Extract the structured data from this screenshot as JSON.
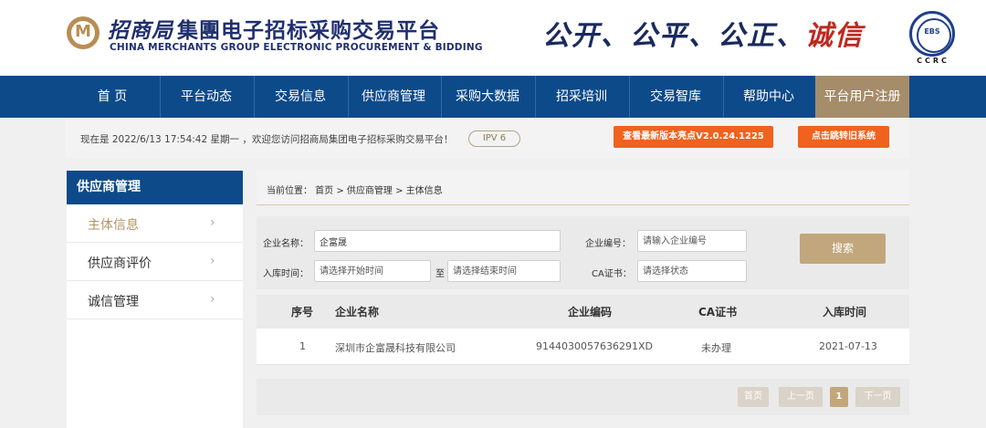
{
  "header": {
    "brand_cn": "招商局",
    "title_cn": "集團电子招标采购交易平台",
    "title_en": "CHINA MERCHANTS GROUP ELECTRONIC PROCUREMENT & BIDDING",
    "slogan_main": "公开、公平、公正、",
    "slogan_red": "诚信",
    "badge_top": "EBS",
    "badge_bottom": "CCRC"
  },
  "nav": {
    "items": [
      {
        "label": "首 页"
      },
      {
        "label": "平台动态"
      },
      {
        "label": "交易信息"
      },
      {
        "label": "供应商管理"
      },
      {
        "label": "采购大数据"
      },
      {
        "label": "招采培训"
      },
      {
        "label": "交易智库"
      },
      {
        "label": "帮助中心"
      },
      {
        "label": "平台用户注册"
      }
    ],
    "active_index": 8
  },
  "infobar": {
    "text": "现在是 2022/6/13 17:54:42 星期一 ，欢迎您访问招商局集团电子招标采购交易平台！",
    "ipv6": "IPV 6",
    "btn_new_version": "查看最新版本亮点V2.0.24.1225",
    "btn_old_system": "点击跳转旧系统"
  },
  "sidebar": {
    "title": "供应商管理",
    "items": [
      {
        "label": "主体信息"
      },
      {
        "label": "供应商评价"
      },
      {
        "label": "诚信管理"
      }
    ],
    "chevron": "›"
  },
  "breadcrumb": "当前位置： 首页 > 供应商管理 > 主体信息",
  "search": {
    "company_name_label": "企业名称：",
    "company_name_value": "企富晟",
    "company_code_label": "企业编号：",
    "company_code_placeholder": "请输入企业编号",
    "date_label": "入库时间：",
    "date_start_placeholder": "请选择开始时间",
    "date_to": "至",
    "date_end_placeholder": "请选择结束时间",
    "ca_label": "CA证书：",
    "ca_placeholder": "请选择状态",
    "search_button": "搜索"
  },
  "table": {
    "headers": [
      "序号",
      "企业名称",
      "企业编码",
      "CA证书",
      "入库时间"
    ],
    "rows": [
      [
        "1",
        "深圳市企富晟科技有限公司",
        "9144030057636291XD",
        "未办理",
        "2021-07-13"
      ]
    ]
  },
  "pagination": {
    "first": "首页",
    "prev": "上一页",
    "current": "1",
    "next": "下一页"
  },
  "colors": {
    "nav_blue": "#0d4a8a",
    "gold": "#c2a77c",
    "orange": "#f0621e"
  }
}
